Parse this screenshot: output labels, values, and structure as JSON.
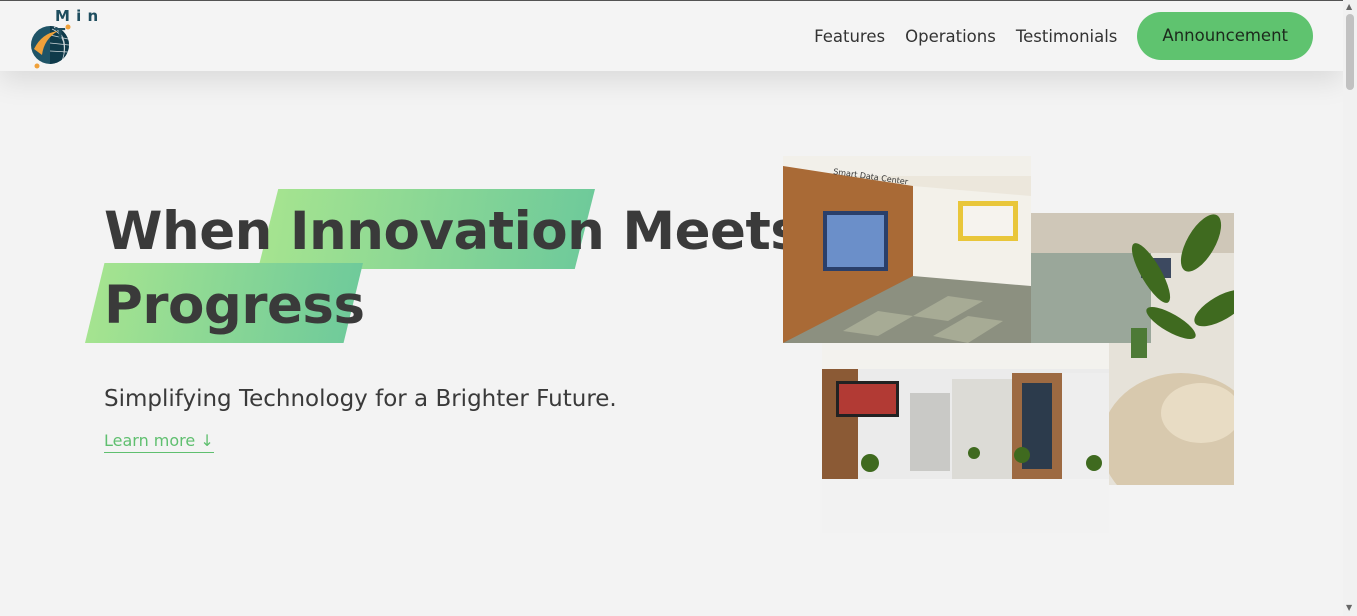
{
  "brand": {
    "logo_text": "M i n T"
  },
  "nav": {
    "items": [
      "Features",
      "Operations",
      "Testimonials"
    ],
    "cta": "Announcement"
  },
  "hero": {
    "title_line1_a": "When ",
    "title_line1_b": "Innovation",
    "title_line1_c": " Meets",
    "title_line2": "Progress",
    "subtitle": "Simplifying Technology for a Brighter Future.",
    "learn_more": "Learn more ↓"
  },
  "photos": {
    "photo1_sign": "Smart Data Center"
  },
  "colors": {
    "accent": "#5fc36f",
    "highlight_start": "#a8e58f",
    "highlight_end": "#6cc99b"
  }
}
